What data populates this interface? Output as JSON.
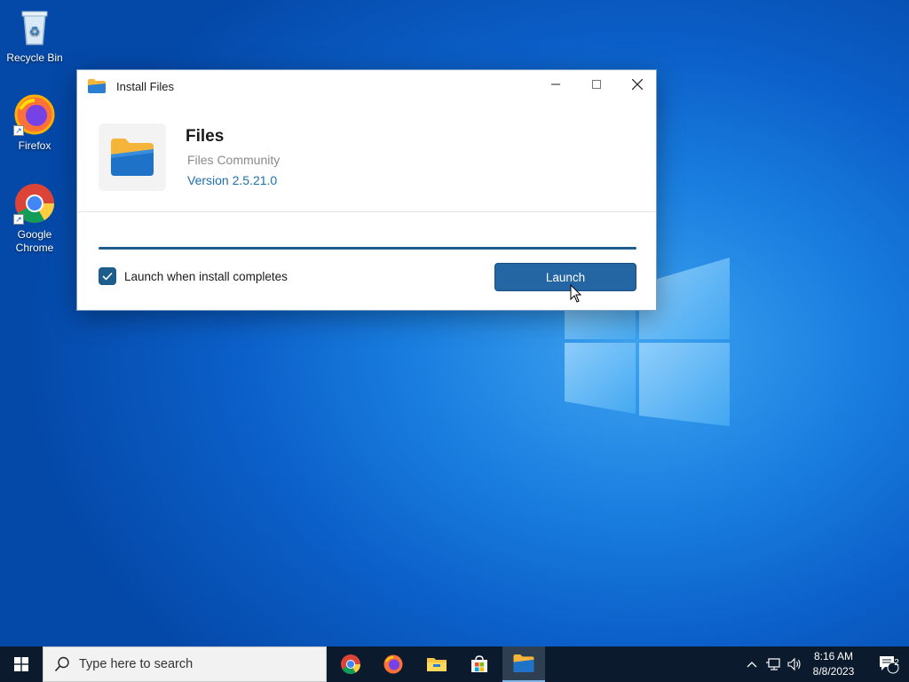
{
  "desktop": {
    "icons": [
      {
        "label": "Recycle Bin"
      },
      {
        "label": "Firefox"
      },
      {
        "label": "Google Chrome"
      }
    ]
  },
  "dialog": {
    "title": "Install Files",
    "app_name": "Files",
    "publisher": "Files Community",
    "version": "Version 2.5.21.0",
    "progress": 1.0,
    "checkbox_label": "Launch when install completes",
    "checkbox_checked": true,
    "launch_label": "Launch"
  },
  "taskbar": {
    "search_placeholder": "Type here to search",
    "apps": [
      "chrome-icon",
      "firefox-icon",
      "file-explorer-icon",
      "microsoft-store-icon",
      "files-app-icon"
    ],
    "time": "8:16 AM",
    "date": "8/8/2023",
    "notification_count": "2"
  },
  "colors": {
    "accent": "#2366a3",
    "taskbar": "#0b1a2c"
  }
}
